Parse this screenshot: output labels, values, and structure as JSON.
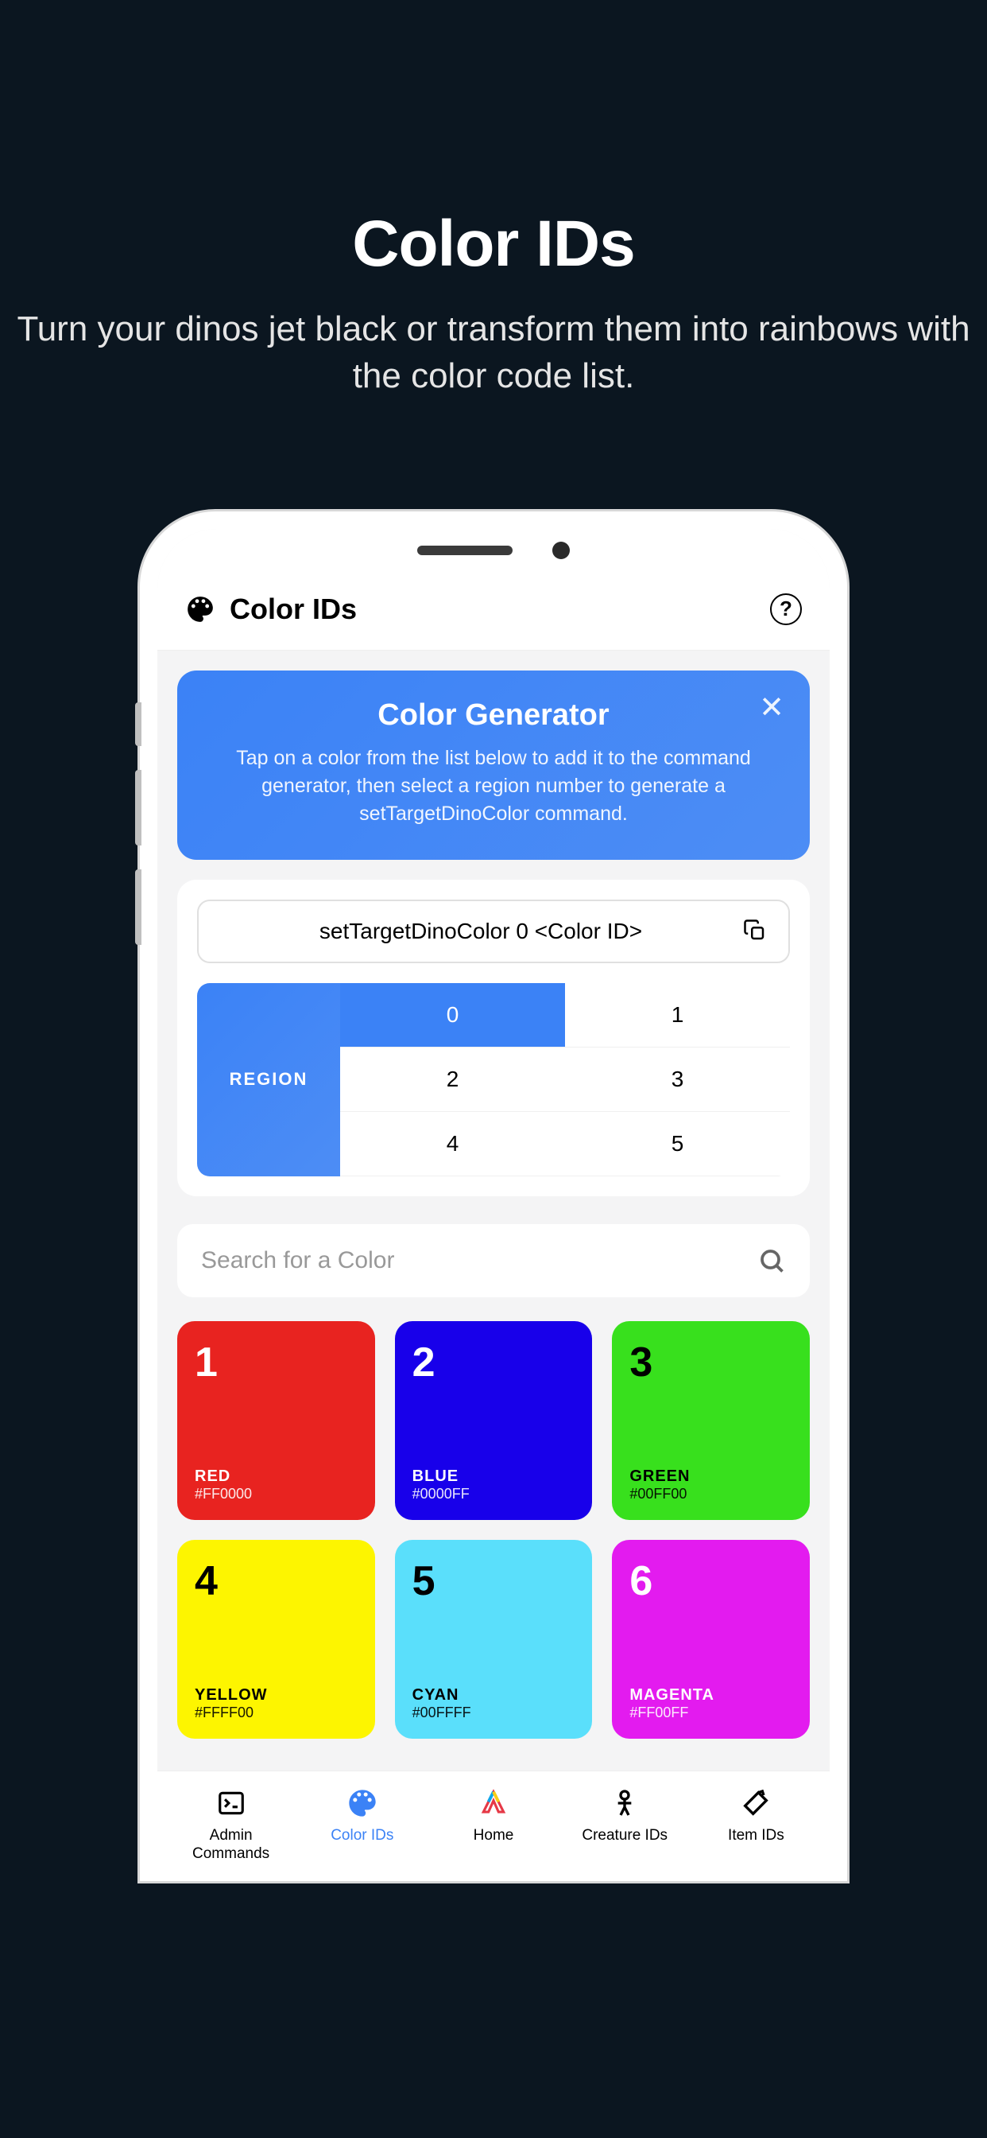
{
  "hero": {
    "title": "Color IDs",
    "description": "Turn your dinos jet black or transform them into rainbows with the color code list."
  },
  "header": {
    "title": "Color IDs"
  },
  "generator": {
    "title": "Color Generator",
    "description": "Tap on a color from the list below to add it to the command generator, then select a region number to generate a setTargetDinoColor command."
  },
  "command": {
    "text": "setTargetDinoColor 0 <Color ID>"
  },
  "region": {
    "label": "REGION",
    "options": [
      "0",
      "1",
      "2",
      "3",
      "4",
      "5"
    ],
    "selected": "0"
  },
  "search": {
    "placeholder": "Search for a Color"
  },
  "colors": [
    {
      "id": "1",
      "name": "RED",
      "hex": "#FF0000",
      "bg": "#E82320",
      "fg": "#ffffff"
    },
    {
      "id": "2",
      "name": "BLUE",
      "hex": "#0000FF",
      "bg": "#1800EA",
      "fg": "#ffffff"
    },
    {
      "id": "3",
      "name": "GREEN",
      "hex": "#00FF00",
      "bg": "#38E01D",
      "fg": "#000000"
    },
    {
      "id": "4",
      "name": "YELLOW",
      "hex": "#FFFF00",
      "bg": "#FDF500",
      "fg": "#000000"
    },
    {
      "id": "5",
      "name": "CYAN",
      "hex": "#00FFFF",
      "bg": "#5ADFFB",
      "fg": "#000000"
    },
    {
      "id": "6",
      "name": "MAGENTA",
      "hex": "#FF00FF",
      "bg": "#E31BEF",
      "fg": "#ffffff"
    }
  ],
  "tabs": [
    {
      "label": "Admin Commands",
      "active": false
    },
    {
      "label": "Color IDs",
      "active": true
    },
    {
      "label": "Home",
      "active": false
    },
    {
      "label": "Creature IDs",
      "active": false
    },
    {
      "label": "Item IDs",
      "active": false
    }
  ]
}
